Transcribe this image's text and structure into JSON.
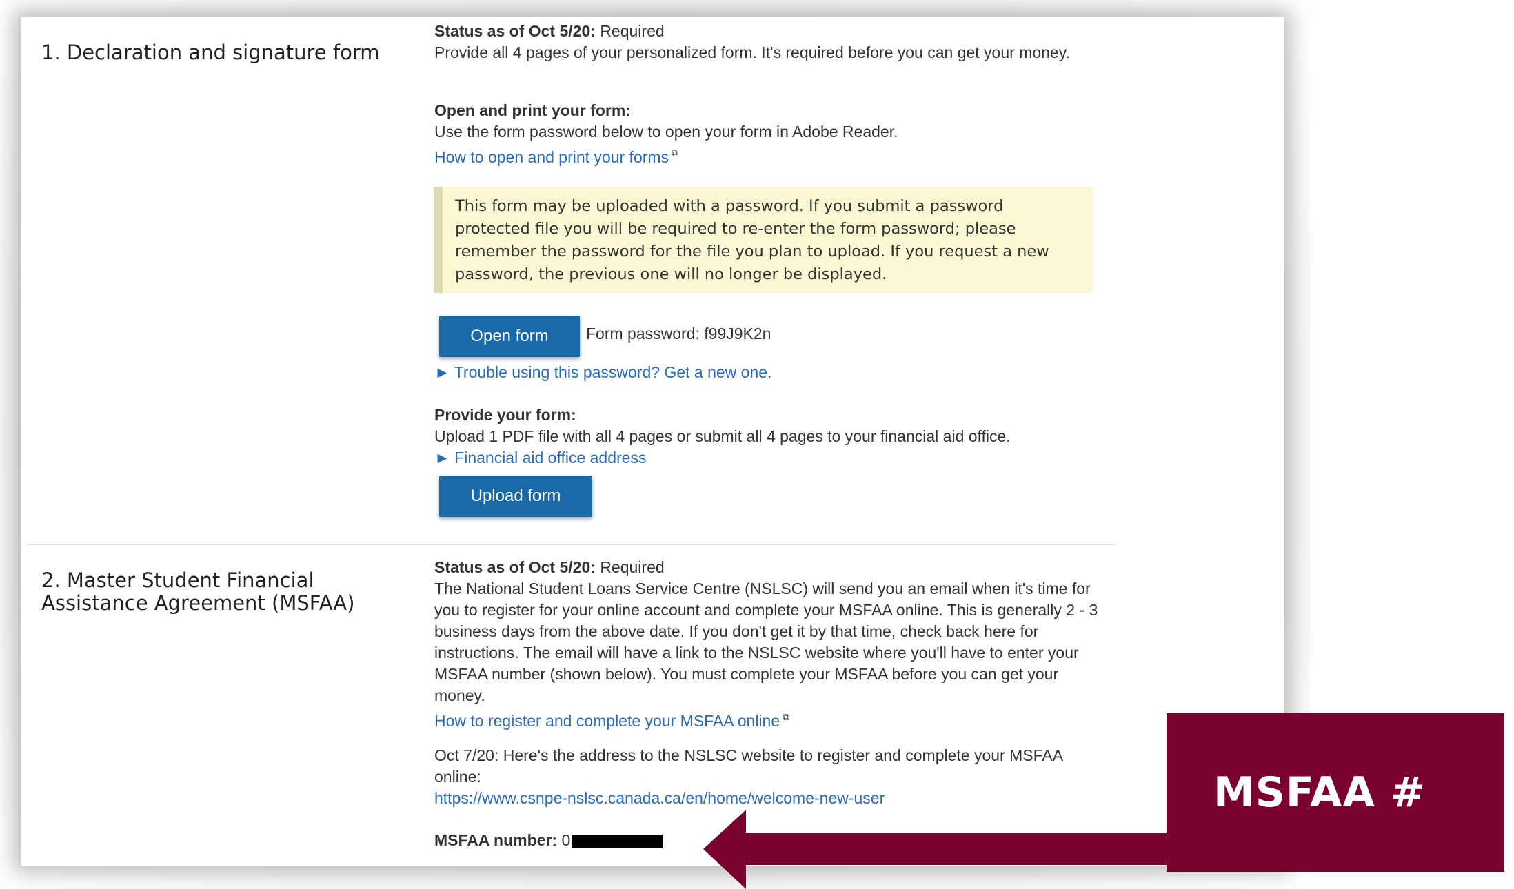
{
  "section1": {
    "title": "1. Declaration and signature form",
    "status_label": "Status as of Oct 5/20:",
    "status_value": "Required",
    "description": "Provide all 4 pages of your personalized form. It's required before you can get your money.",
    "open_print_heading": "Open and print your form:",
    "open_print_text": "Use the form password below to open your form in Adobe Reader.",
    "open_print_link": "How to open and print your forms",
    "note": "This form may be uploaded with a password. If you submit a password protected file you will be required to re-enter the form password; please remember the password for the file you plan to upload. If you request a new password, the previous one will no longer be displayed.",
    "open_button": "Open form",
    "password_text": "Form password: f99J9K2n",
    "trouble_link": "► Trouble using this password? Get a new one.",
    "provide_heading": "Provide your form:",
    "provide_text": "Upload 1 PDF file with all 4 pages or submit all 4 pages to your financial aid office.",
    "office_link": "► Financial aid office address",
    "upload_button": "Upload form"
  },
  "section2": {
    "title": "2. Master Student Financial Assistance Agreement (MSFAA)",
    "status_label": "Status as of Oct 5/20:",
    "status_value": "Required",
    "description": "The National Student Loans Service Centre (NSLSC) will send you an email when it's time for you to register for your online account and complete your MSFAA online. This is generally 2 - 3 business days from the above date. If you don't get it by that time, check back here for instructions. The email will have a link to the NSLSC website where you'll have to enter your MSFAA number (shown below). You must complete your MSFAA before you can get your money.",
    "register_link": "How to register and complete your MSFAA online",
    "update_text": "Oct 7/20: Here's the address to the NSLSC website to register and complete your MSFAA online:",
    "nslsc_url": "https://www.csnpe-nslsc.canada.ca/en/home/welcome-new-user",
    "msfaa_label": "MSFAA number:",
    "msfaa_value_prefix": "0"
  },
  "callout": {
    "text": "MSFAA #",
    "color": "#7a0030"
  },
  "colors": {
    "link": "#2a6bb5",
    "button": "#1a6aab",
    "note_bg": "#f9f8d2"
  }
}
